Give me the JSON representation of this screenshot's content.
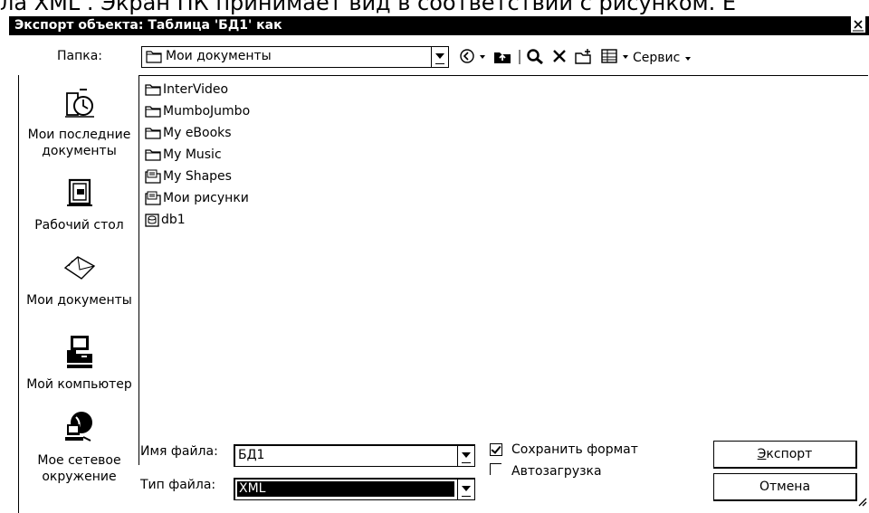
{
  "doc_text": "ла XML . Экран ПК принимает вид в соответствии с рисунком. Е",
  "window": {
    "title": "Экспорт объекта: Таблица 'БД1' как",
    "close_glyph": "×"
  },
  "folder": {
    "label": "Папка:",
    "value": "Мои документы"
  },
  "toolbar": {
    "service_label": "Сервис"
  },
  "places": [
    {
      "label": "Мои последние документы",
      "icon": "recent-documents-icon"
    },
    {
      "label": "Рабочий стол",
      "icon": "desktop-icon"
    },
    {
      "label": "Мои документы",
      "icon": "my-documents-icon"
    },
    {
      "label": "Мой компьютер",
      "icon": "my-computer-icon"
    },
    {
      "label": "Мое сетевое окружение",
      "icon": "network-icon"
    }
  ],
  "files": [
    {
      "name": "InterVideo",
      "icon": "folder-icon"
    },
    {
      "name": "MumboJumbo",
      "icon": "folder-icon"
    },
    {
      "name": "My eBooks",
      "icon": "folder-icon"
    },
    {
      "name": "My Music",
      "icon": "folder-icon"
    },
    {
      "name": "My Shapes",
      "icon": "special-folder-icon"
    },
    {
      "name": "Мои рисунки",
      "icon": "special-folder-icon"
    },
    {
      "name": "db1",
      "icon": "database-file-icon"
    }
  ],
  "form": {
    "filename_label": "Имя файла:",
    "filename_value": "БД1",
    "filetype_label": "Тип файла:",
    "filetype_value": "XML",
    "save_format_label": "Сохранить формат",
    "save_format_checked": true,
    "autoload_label": "Автозагрузка",
    "autoload_checked": false
  },
  "buttons": {
    "export_label_first": "Э",
    "export_label_rest": "кспорт",
    "cancel_label": "Отмена"
  }
}
